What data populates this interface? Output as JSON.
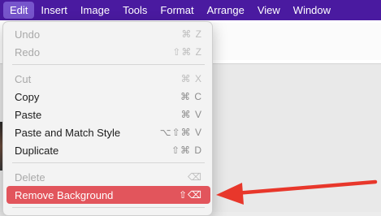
{
  "menubar": {
    "items": [
      {
        "label": "Edit"
      },
      {
        "label": "Insert"
      },
      {
        "label": "Image"
      },
      {
        "label": "Tools"
      },
      {
        "label": "Format"
      },
      {
        "label": "Arrange"
      },
      {
        "label": "View"
      },
      {
        "label": "Window"
      }
    ]
  },
  "menu": {
    "items": [
      {
        "label": "Undo",
        "shortcut": "⌘ Z",
        "enabled": false
      },
      {
        "label": "Redo",
        "shortcut": "⇧⌘ Z",
        "enabled": false
      },
      {
        "label": "Cut",
        "shortcut": "⌘ X",
        "enabled": false
      },
      {
        "label": "Copy",
        "shortcut": "⌘ C",
        "enabled": true
      },
      {
        "label": "Paste",
        "shortcut": "⌘ V",
        "enabled": true
      },
      {
        "label": "Paste and Match Style",
        "shortcut": "⌥⇧⌘ V",
        "enabled": true
      },
      {
        "label": "Duplicate",
        "shortcut": "⇧⌘ D",
        "enabled": true
      },
      {
        "label": "Delete",
        "shortcut": "⌫",
        "enabled": false
      },
      {
        "label": "Remove Background",
        "shortcut": "⇧⌫",
        "enabled": true,
        "highlighted": true
      }
    ]
  },
  "colors": {
    "menubar_bg": "#4a1aa0",
    "highlight": "#e2555c",
    "arrow": "#e8372b"
  }
}
